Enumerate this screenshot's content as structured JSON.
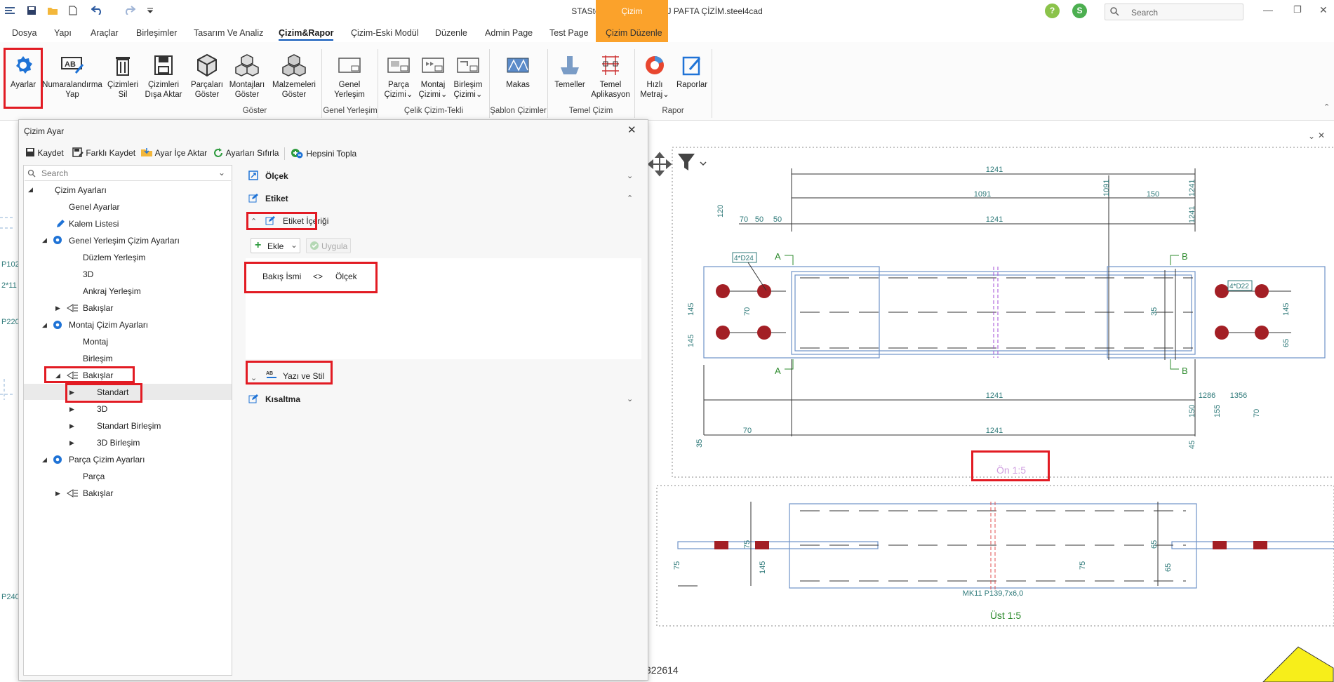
{
  "titlebar": {
    "title": "STASteel 3.2.45 -MONTAJ PAFTA ÇİZİM.steel4cad",
    "search_placeholder": "Search",
    "user_initial": "S",
    "help": "?",
    "minimize": "—",
    "restore": "❐",
    "close": "✕",
    "context_tab_label": "Çizim"
  },
  "menu": {
    "tabs": [
      "Dosya",
      "Yapı",
      "Araçlar",
      "Birleşimler",
      "Tasarım Ve Analiz",
      "Çizim&Rapor",
      "Çizim-Eski Modül",
      "Düzenle",
      "Admin Page",
      "Test Page",
      "Çizim Düzenle"
    ],
    "active": "Çizim&Rapor"
  },
  "ribbon": {
    "buttons": [
      {
        "l1": "Ayarlar",
        "l2": ""
      },
      {
        "l1": "Numaralandırma",
        "l2": "Yap"
      },
      {
        "l1": "Çizimleri",
        "l2": "Sil"
      },
      {
        "l1": "Çizimleri",
        "l2": "Dışa Aktar"
      },
      {
        "l1": "Parçaları",
        "l2": "Göster"
      },
      {
        "l1": "Montajları",
        "l2": "Göster"
      },
      {
        "l1": "Malzemeleri",
        "l2": "Göster"
      },
      {
        "l1": "Genel",
        "l2": "Yerleşim"
      },
      {
        "l1": "Parça",
        "l2": "Çizimi"
      },
      {
        "l1": "Montaj",
        "l2": "Çizimi"
      },
      {
        "l1": "Birleşim",
        "l2": "Çizimi"
      },
      {
        "l1": "Makas",
        "l2": ""
      },
      {
        "l1": "Temeller",
        "l2": ""
      },
      {
        "l1": "Temel",
        "l2": "Aplikasyon"
      },
      {
        "l1": "Hızlı",
        "l2": "Metraj"
      },
      {
        "l1": "Raporlar",
        "l2": ""
      }
    ],
    "groups": [
      "Göster",
      "Genel Yerleşim",
      "Çelik Çizim-Tekli",
      "Şablon Çizimler",
      "Temel Çizim",
      "Rapor"
    ],
    "colors": {
      "accent": "#0b56b8",
      "context": "#fba22b",
      "highlight": "#e21b23"
    }
  },
  "dialog": {
    "title": "Çizim Ayar",
    "close": "✕",
    "toolbar": [
      "Kaydet",
      "Farklı Kaydet",
      "Ayar İçe Aktar",
      "Ayarları Sıfırla",
      "Hepsini Topla"
    ],
    "tree_search_placeholder": "Search",
    "tree": [
      "Çizim Ayarları",
      "Genel Ayarlar",
      "Kalem Listesi",
      "Genel Yerleşim Çizim Ayarları",
      "Düzlem Yerleşim",
      "3D",
      "Ankraj Yerleşim",
      "Bakışlar",
      "Montaj Çizim Ayarları",
      "Montaj",
      "Birleşim",
      "Bakışlar",
      "Standart",
      "3D",
      "Standart Birleşim",
      "3D Birleşim",
      "Parça Çizim Ayarları",
      "Parça",
      "Bakışlar"
    ],
    "sections": {
      "olcek": "Ölçek",
      "etiket": "Etiket",
      "etiket_icerigi": "Etiket İçeriği",
      "ekle": "Ekle",
      "uygula": "Uygula",
      "yazi_stil": "Yazı ve Stil",
      "kisaltma": "Kısaltma"
    },
    "tokens": [
      "Bakış İsmi",
      "<>",
      "Ölçek"
    ]
  },
  "drawing": {
    "view_label_front": "Ön 1:5",
    "view_label_top": "Üst 1:5",
    "profile_label": "MK11 P139,7x6,0",
    "section_a": "A",
    "section_b": "B",
    "bolt_left": "4*D24",
    "bolt_right": "4*D22",
    "dims": [
      "1241",
      "1091",
      "1241",
      "150",
      "70",
      "50",
      "120",
      "1091",
      "1241",
      "1241",
      "1241",
      "1241",
      "150",
      "45",
      "70",
      "1286",
      "1356",
      "155",
      "70",
      "35",
      "145",
      "145",
      "70",
      "35",
      "145",
      "65",
      "75",
      "145",
      "75",
      "65"
    ],
    "bottom_number": "322614",
    "side_labels": [
      "P102",
      "2*11",
      "P220",
      "P240"
    ]
  }
}
